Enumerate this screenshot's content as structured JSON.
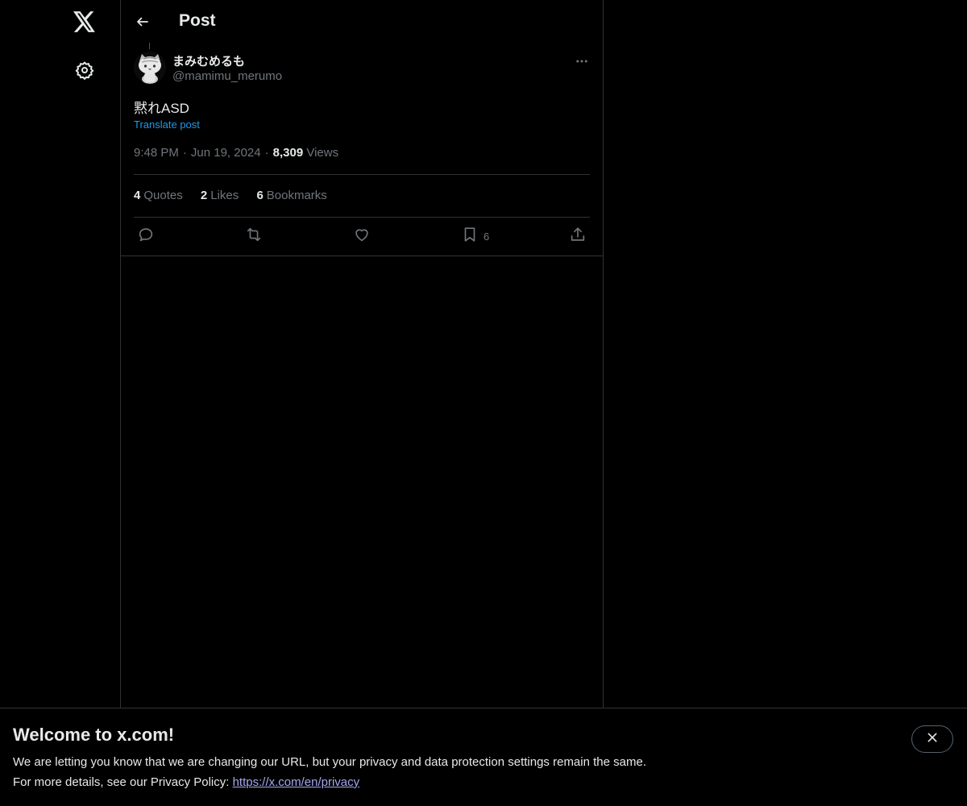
{
  "header": {
    "title": "Post"
  },
  "post": {
    "author_name": "まみむめるも",
    "author_handle": "@mamimu_merumo",
    "text": "黙れASD",
    "translate_label": "Translate post",
    "time": "9:48 PM",
    "date": "Jun 19, 2024",
    "views_count": "8,309",
    "views_label": "Views",
    "separator": "·"
  },
  "stats": {
    "quotes_count": "4",
    "quotes_label": "Quotes",
    "likes_count": "2",
    "likes_label": "Likes",
    "bookmarks_count": "6",
    "bookmarks_label": "Bookmarks"
  },
  "actions": {
    "bookmark_count": "6"
  },
  "banner": {
    "title": "Welcome to x.com!",
    "line1": "We are letting you know that we are changing our URL, but your privacy and data protection settings remain the same.",
    "line2_prefix": "For more details, see our Privacy Policy: ",
    "link_text": "https://x.com/en/privacy"
  },
  "icons": {
    "logo": "x-logo-icon",
    "settings": "gear-icon",
    "back": "arrow-left-icon",
    "more": "more-horizontal-icon",
    "reply": "reply-icon",
    "repost": "repost-icon",
    "like": "heart-icon",
    "bookmark": "bookmark-icon",
    "share": "share-icon",
    "close": "close-icon"
  },
  "colors": {
    "background": "#000000",
    "text": "#e7e9ea",
    "muted": "#71767b",
    "link": "#1d9bf0",
    "border": "#2f3336"
  }
}
